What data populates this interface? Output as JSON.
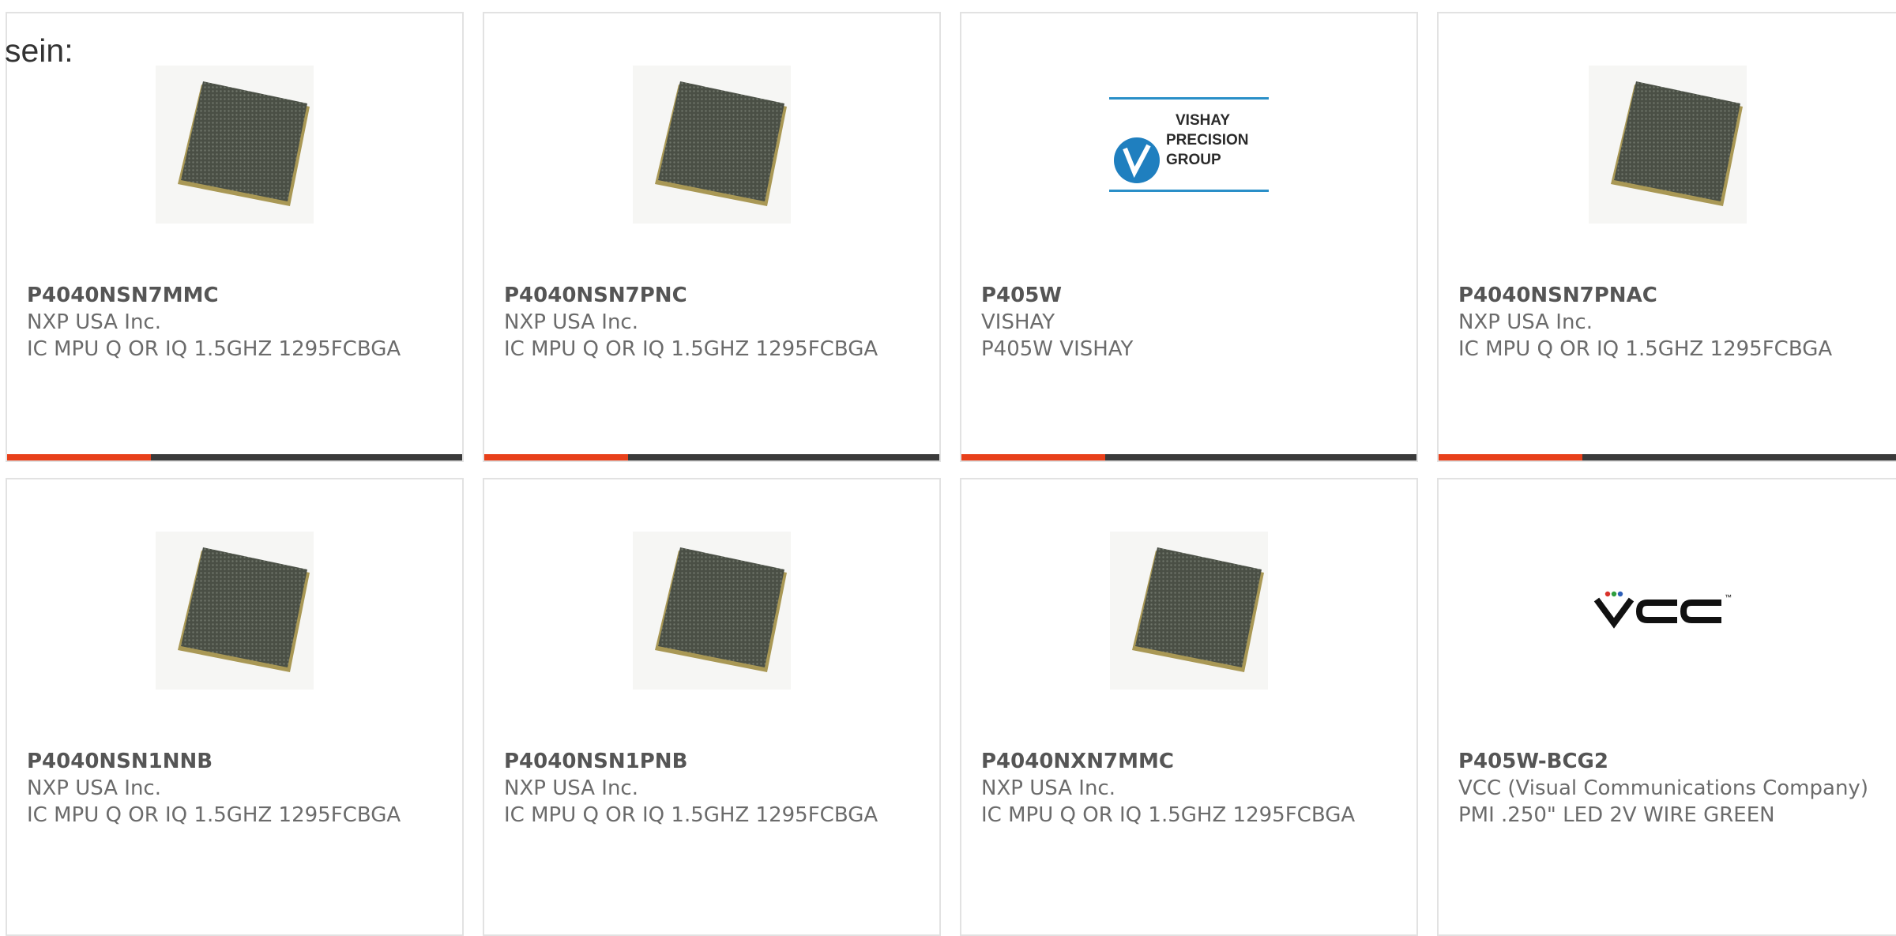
{
  "lead_text": "sein:",
  "colors": {
    "accent_bar": "#e8401a",
    "bar_base": "#3a3a3a",
    "card_border": "#e2e2e2",
    "text_muted": "#6b6b6b"
  },
  "products": [
    {
      "part_number": "P4040NSN7MMC",
      "manufacturer": "NXP USA Inc.",
      "description": "IC MPU Q OR IQ 1.5GHZ 1295FCBGA",
      "image": "bga-chip-image"
    },
    {
      "part_number": "P4040NSN7PNC",
      "manufacturer": "NXP USA Inc.",
      "description": "IC MPU Q OR IQ 1.5GHZ 1295FCBGA",
      "image": "bga-chip-image"
    },
    {
      "part_number": "P405W",
      "manufacturer": "VISHAY",
      "description": "P405W VISHAY",
      "image": "vishay-precision-group-logo",
      "logo_lines": [
        "VISHAY",
        "PRECISION",
        "GROUP"
      ]
    },
    {
      "part_number": "P4040NSN7PNAC",
      "manufacturer": "NXP USA Inc.",
      "description": "IC MPU Q OR IQ 1.5GHZ 1295FCBGA",
      "image": "bga-chip-image"
    },
    {
      "part_number": "P4040NSN1NNB",
      "manufacturer": "NXP USA Inc.",
      "description": "IC MPU Q OR IQ 1.5GHZ 1295FCBGA",
      "image": "bga-chip-image"
    },
    {
      "part_number": "P4040NSN1PNB",
      "manufacturer": "NXP USA Inc.",
      "description": "IC MPU Q OR IQ 1.5GHZ 1295FCBGA",
      "image": "bga-chip-image"
    },
    {
      "part_number": "P4040NXN7MMC",
      "manufacturer": "NXP USA Inc.",
      "description": "IC MPU Q OR IQ 1.5GHZ 1295FCBGA",
      "image": "bga-chip-image"
    },
    {
      "part_number": "P405W-BCG2",
      "manufacturer": "VCC (Visual Communications Company)",
      "description": "PMI .250\" LED 2V WIRE GREEN",
      "image": "vcc-logo",
      "logo_text": "VCC",
      "logo_tm": "™"
    }
  ]
}
